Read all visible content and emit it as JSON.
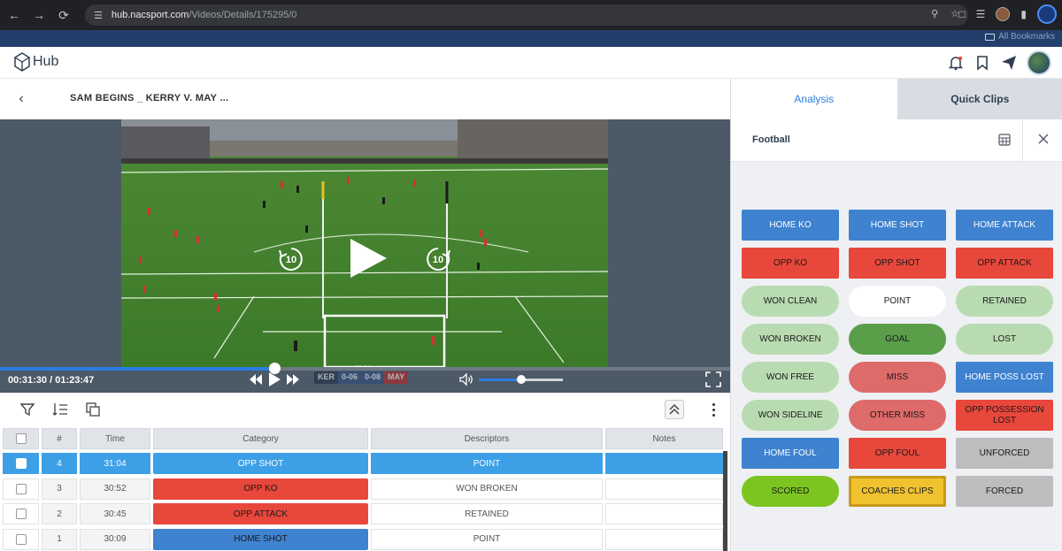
{
  "browser": {
    "url_host": "hub.nacsport.com",
    "url_path": "/Videos/Details/175295/0",
    "bookmarks_label": "All Bookmarks"
  },
  "app": {
    "logo_text": "Hub"
  },
  "video": {
    "title": "SAM BEGINS _ KERRY V. MAY ...",
    "time_current": "00:31:30",
    "time_separator": " / ",
    "time_total": "01:23:47",
    "progress": 0.376,
    "volume": 0.5,
    "rewind_label": "10",
    "forward_label": "10",
    "scorebug": {
      "home": "KER",
      "home_score": "0-06",
      "away_score": "0-08",
      "away": "MAY",
      "clock": "28:01"
    }
  },
  "table": {
    "headers": {
      "num": "#",
      "time": "Time",
      "category": "Category",
      "descriptors": "Descriptors",
      "notes": "Notes"
    },
    "rows": [
      {
        "num": "4",
        "time": "31:04",
        "category": "OPP SHOT",
        "descriptor": "POINT",
        "notes": "",
        "selected": true,
        "cat_color": "#3da0e6"
      },
      {
        "num": "3",
        "time": "30:52",
        "category": "OPP KO",
        "descriptor": "WON BROKEN",
        "notes": "",
        "selected": false,
        "cat_color": "#e8473b"
      },
      {
        "num": "2",
        "time": "30:45",
        "category": "OPP ATTACK",
        "descriptor": "RETAINED",
        "notes": "",
        "selected": false,
        "cat_color": "#e8473b"
      },
      {
        "num": "1",
        "time": "30:09",
        "category": "HOME SHOT",
        "descriptor": "POINT",
        "notes": "",
        "selected": false,
        "cat_color": "#3e82d0"
      }
    ]
  },
  "panel": {
    "tab_analysis": "Analysis",
    "tab_quick_clips": "Quick Clips",
    "subheader": "Football",
    "buttons": [
      {
        "label": "HOME KO",
        "bg": "#3e82d0",
        "fg": "#ffffff",
        "shape": "sq"
      },
      {
        "label": "HOME SHOT",
        "bg": "#3e82d0",
        "fg": "#ffffff",
        "shape": "sq"
      },
      {
        "label": "HOME ATTACK",
        "bg": "#3e82d0",
        "fg": "#ffffff",
        "shape": "sq"
      },
      {
        "label": "OPP KO",
        "bg": "#e8473b",
        "fg": "#1a1a1a",
        "shape": "sq"
      },
      {
        "label": "OPP SHOT",
        "bg": "#e8473b",
        "fg": "#1a1a1a",
        "shape": "sq"
      },
      {
        "label": "OPP ATTACK",
        "bg": "#e8473b",
        "fg": "#1a1a1a",
        "shape": "sq"
      },
      {
        "label": "WON CLEAN",
        "bg": "#b9dbb1",
        "fg": "#1a1a1a",
        "shape": "rd"
      },
      {
        "label": "POINT",
        "bg": "#ffffff",
        "fg": "#1a1a1a",
        "shape": "rd"
      },
      {
        "label": "RETAINED",
        "bg": "#b9dbb1",
        "fg": "#1a1a1a",
        "shape": "rd"
      },
      {
        "label": "WON BROKEN",
        "bg": "#b9dbb1",
        "fg": "#1a1a1a",
        "shape": "rd"
      },
      {
        "label": "GOAL",
        "bg": "#5a9e4a",
        "fg": "#1a1a1a",
        "shape": "rd"
      },
      {
        "label": "LOST",
        "bg": "#b9dbb1",
        "fg": "#1a1a1a",
        "shape": "rd"
      },
      {
        "label": "WON FREE",
        "bg": "#b9dbb1",
        "fg": "#1a1a1a",
        "shape": "rd"
      },
      {
        "label": "MISS",
        "bg": "#df6a6a",
        "fg": "#1a1a1a",
        "shape": "rd"
      },
      {
        "label": "HOME POSS LOST",
        "bg": "#3e82d0",
        "fg": "#ffffff",
        "shape": "sq"
      },
      {
        "label": "WON SIDELINE",
        "bg": "#b9dbb1",
        "fg": "#1a1a1a",
        "shape": "rd"
      },
      {
        "label": "OTHER MISS",
        "bg": "#df6a6a",
        "fg": "#1a1a1a",
        "shape": "rd"
      },
      {
        "label": "OPP POSSESSION LOST",
        "bg": "#e8473b",
        "fg": "#1a1a1a",
        "shape": "sq"
      },
      {
        "label": "HOME FOUL",
        "bg": "#3e82d0",
        "fg": "#ffffff",
        "shape": "sq"
      },
      {
        "label": "OPP FOUL",
        "bg": "#e8473b",
        "fg": "#1a1a1a",
        "shape": "sq"
      },
      {
        "label": "UNFORCED",
        "bg": "#bdbdbd",
        "fg": "#1a1a1a",
        "shape": "sq"
      },
      {
        "label": "SCORED",
        "bg": "#7cc520",
        "fg": "#1a1a1a",
        "shape": "rd"
      },
      {
        "label": "COACHES CLIPS",
        "bg": "#f0c230",
        "fg": "#1a1a1a",
        "shape": "sq"
      },
      {
        "label": "FORCED",
        "bg": "#bdbdbd",
        "fg": "#1a1a1a",
        "shape": "sq"
      }
    ]
  },
  "colors": {
    "accent": "#2a7de1",
    "header_dark": "#202124",
    "bookmarks_bg": "#223e6a"
  }
}
